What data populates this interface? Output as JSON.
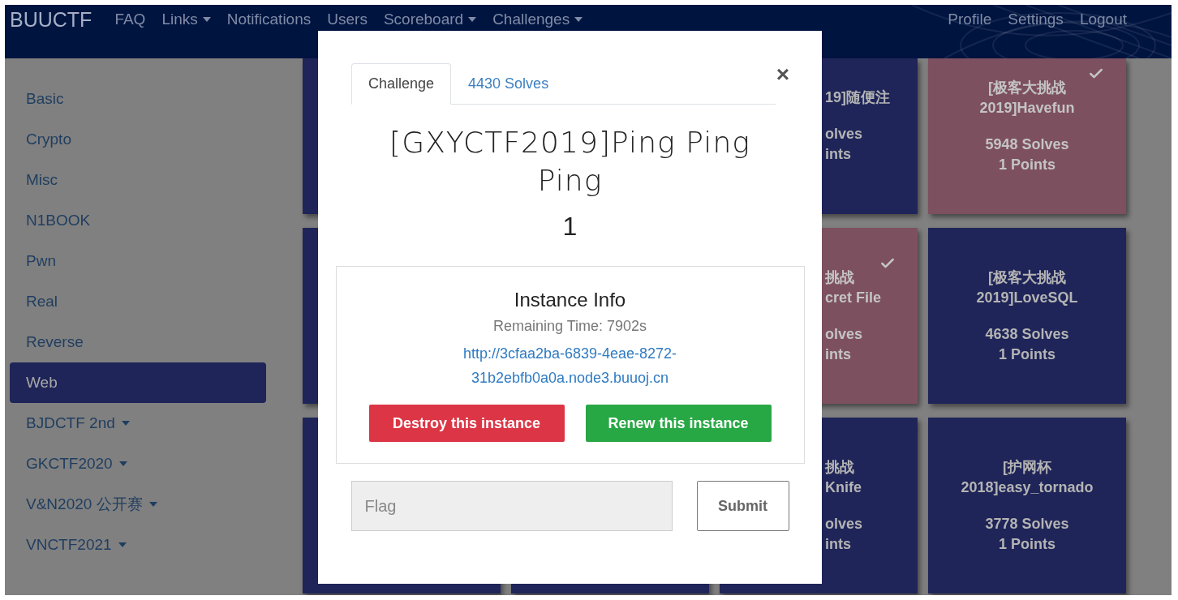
{
  "navbar": {
    "brand": "BUUCTF",
    "links": [
      {
        "label": "FAQ",
        "dropdown": false
      },
      {
        "label": "Links",
        "dropdown": true
      },
      {
        "label": "Notifications",
        "dropdown": false
      },
      {
        "label": "Users",
        "dropdown": false
      },
      {
        "label": "Scoreboard",
        "dropdown": true
      },
      {
        "label": "Challenges",
        "dropdown": true
      }
    ],
    "right_links": [
      "Profile",
      "Settings",
      "Logout"
    ]
  },
  "sidebar": {
    "items": [
      {
        "label": "Basic",
        "selected": false,
        "dropdown": false
      },
      {
        "label": "Crypto",
        "selected": false,
        "dropdown": false
      },
      {
        "label": "Misc",
        "selected": false,
        "dropdown": false
      },
      {
        "label": "N1BOOK",
        "selected": false,
        "dropdown": false
      },
      {
        "label": "Pwn",
        "selected": false,
        "dropdown": false
      },
      {
        "label": "Real",
        "selected": false,
        "dropdown": false
      },
      {
        "label": "Reverse",
        "selected": false,
        "dropdown": false
      },
      {
        "label": "Web",
        "selected": true,
        "dropdown": false
      },
      {
        "label": "BJDCTF 2nd",
        "selected": false,
        "dropdown": true
      },
      {
        "label": "GKCTF2020",
        "selected": false,
        "dropdown": true
      },
      {
        "label": "V&N2020 公开赛",
        "selected": false,
        "dropdown": true
      },
      {
        "label": "VNCTF2021",
        "selected": false,
        "dropdown": true
      }
    ]
  },
  "card_rows": [
    [
      {
        "kind": "strip",
        "solved": false
      },
      {
        "kind": "covered"
      },
      {
        "kind": "partial",
        "solved": false,
        "title_lines": [
          "19]随便注"
        ],
        "solves": "olves",
        "points": "ints"
      },
      {
        "kind": "full",
        "solved": true,
        "title": "[极客大挑战 2019]Havefun",
        "solves": "5948 Solves",
        "points": "1 Points"
      }
    ],
    [
      {
        "kind": "strip",
        "solved": false
      },
      {
        "kind": "covered"
      },
      {
        "kind": "partial",
        "solved": true,
        "title_lines": [
          "挑战",
          "cret File"
        ],
        "solves": "olves",
        "points": "ints"
      },
      {
        "kind": "full",
        "solved": false,
        "title": "[极客大挑战 2019]LoveSQL",
        "solves": "4638 Solves",
        "points": "1 Points"
      }
    ],
    [
      {
        "kind": "strip",
        "solved": false
      },
      {
        "kind": "strip",
        "solved": false
      },
      {
        "kind": "partial",
        "solved": false,
        "title_lines": [
          "挑战",
          "Knife"
        ],
        "solves": "olves",
        "points": "ints"
      },
      {
        "kind": "full",
        "solved": false,
        "title": "[护网杯 2018]easy_tornado",
        "solves": "3778 Solves",
        "points": "1 Points"
      }
    ]
  ],
  "modal": {
    "tabs": [
      {
        "label": "Challenge",
        "selected": true
      },
      {
        "label": "4430 Solves",
        "selected": false
      }
    ],
    "close": "×",
    "title": "[GXYCTF2019]Ping Ping Ping",
    "points": "1",
    "instance": {
      "heading": "Instance Info",
      "remaining": "Remaining Time: 7902s",
      "url": "http://3cfaa2ba-6839-4eae-8272-31b2ebfb0a0a.node3.buuoj.cn",
      "buttons": [
        {
          "label": "Destroy this instance",
          "kind": "danger"
        },
        {
          "label": "Renew this instance",
          "kind": "success"
        }
      ]
    },
    "flag": {
      "placeholder": "Flag"
    },
    "submit": "Submit"
  }
}
